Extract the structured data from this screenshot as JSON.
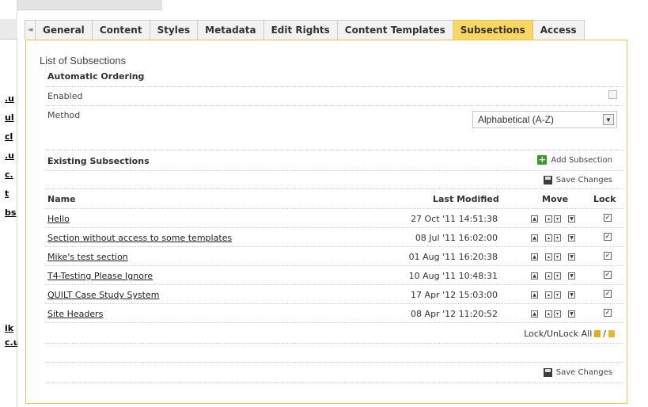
{
  "tabs": [
    {
      "label": "General",
      "active": false
    },
    {
      "label": "Content",
      "active": false
    },
    {
      "label": "Styles",
      "active": false
    },
    {
      "label": "Metadata",
      "active": false
    },
    {
      "label": "Edit Rights",
      "active": false
    },
    {
      "label": "Content Templates",
      "active": false
    },
    {
      "label": "Subsections",
      "active": true
    },
    {
      "label": "Access",
      "active": false
    }
  ],
  "left_links": [
    ".u",
    "ul",
    "cl",
    ".u",
    "c.",
    "t",
    "bs",
    "ik",
    "c.u"
  ],
  "panel": {
    "title": "List of Subsections",
    "automatic_ordering": {
      "heading": "Automatic Ordering",
      "enabled_label": "Enabled",
      "enabled": false,
      "method_label": "Method",
      "method_value": "Alphabetical (A-Z)"
    },
    "existing": {
      "heading": "Existing Subsections",
      "add_label": "Add Subsection",
      "save_label": "Save Changes"
    },
    "columns": {
      "name": "Name",
      "last_modified": "Last Modified",
      "move": "Move",
      "lock": "Lock"
    },
    "subsections": [
      {
        "name": "Hello",
        "last_modified": "27 Oct '11 14:51:38",
        "locked": true
      },
      {
        "name": "Section without access to some templates",
        "last_modified": "08 Jul '11 16:02:00",
        "locked": true
      },
      {
        "name": "Mike's test section",
        "last_modified": "01 Aug '11 16:20:38",
        "locked": true
      },
      {
        "name": "T4-Testing Please Ignore",
        "last_modified": "10 Aug '11 10:48:31",
        "locked": true
      },
      {
        "name": "QUILT Case Study System",
        "last_modified": "17 Apr '12 15:03:00",
        "locked": true
      },
      {
        "name": "Site Headers",
        "last_modified": "08 Apr '12 11:20:52",
        "locked": true
      }
    ],
    "lock_all_label": "Lock/UnLock All",
    "lock_all_separator": "/",
    "bottom_save_label": "Save Changes"
  }
}
